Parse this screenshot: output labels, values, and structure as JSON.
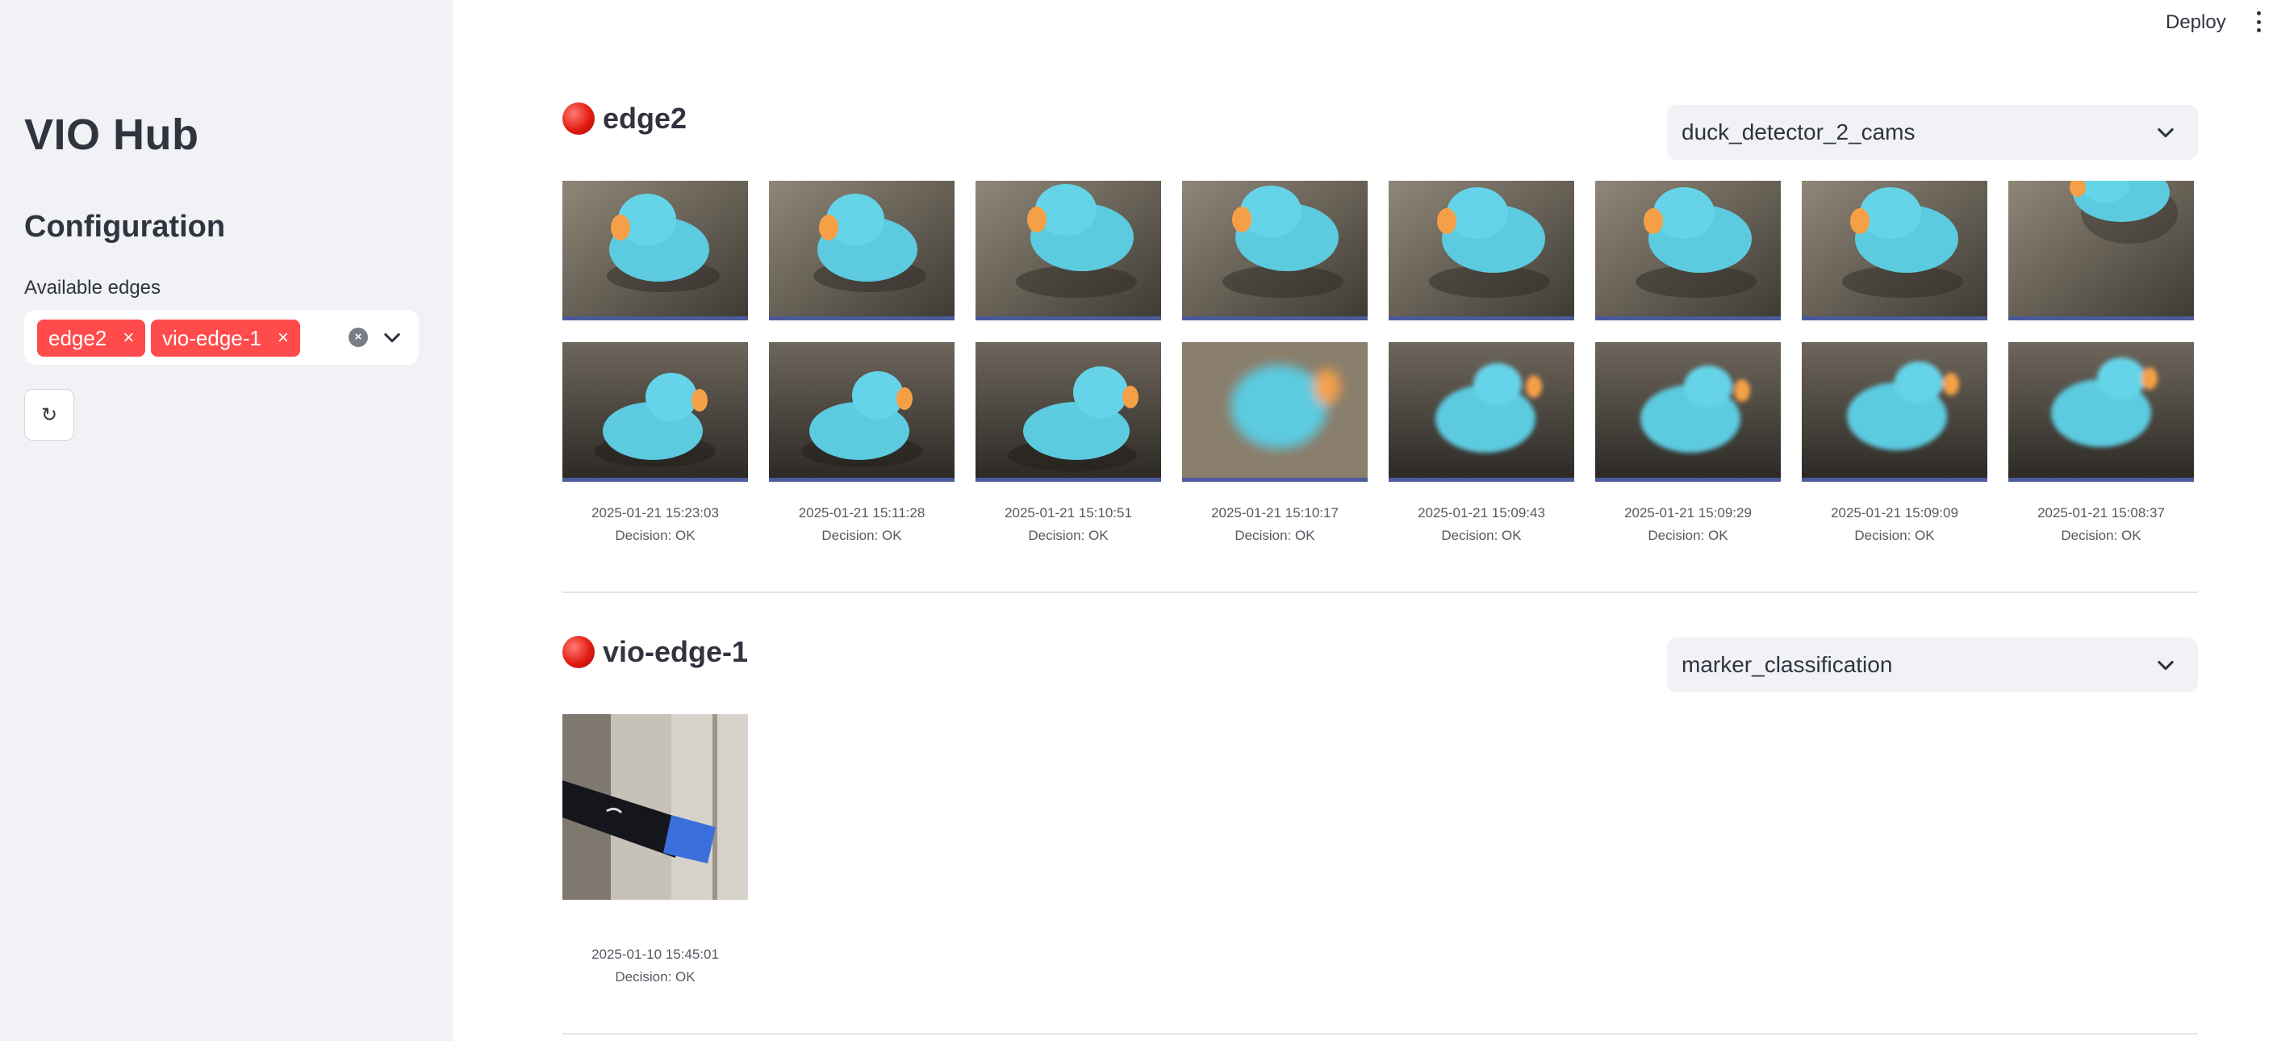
{
  "sidebar": {
    "app_title": "VIO Hub",
    "config_title": "Configuration",
    "edges_label": "Available edges",
    "selected_edges": [
      "edge2",
      "vio-edge-1"
    ],
    "chip_remove": "×",
    "clear_all": "×",
    "refresh_label": "↻"
  },
  "header": {
    "deploy_label": "Deploy"
  },
  "sections": [
    {
      "edge": "edge2",
      "selected_model": "duck_detector_2_cams",
      "images": [
        {
          "timestamp": "2025-01-21 15:23:03",
          "decision": "Decision: OK"
        },
        {
          "timestamp": "2025-01-21 15:11:28",
          "decision": "Decision: OK"
        },
        {
          "timestamp": "2025-01-21 15:10:51",
          "decision": "Decision: OK"
        },
        {
          "timestamp": "2025-01-21 15:10:17",
          "decision": "Decision: OK"
        },
        {
          "timestamp": "2025-01-21 15:09:43",
          "decision": "Decision: OK"
        },
        {
          "timestamp": "2025-01-21 15:09:29",
          "decision": "Decision: OK"
        },
        {
          "timestamp": "2025-01-21 15:09:09",
          "decision": "Decision: OK"
        },
        {
          "timestamp": "2025-01-21 15:08:37",
          "decision": "Decision: OK"
        }
      ]
    },
    {
      "edge": "vio-edge-1",
      "selected_model": "marker_classification",
      "images": [
        {
          "timestamp": "2025-01-10 15:45:01",
          "decision": "Decision: OK"
        }
      ]
    }
  ],
  "colors": {
    "accent": "#ff4b4b",
    "sidebar_bg": "#f0f2f6",
    "text": "#31333f",
    "duck": "#5ccbe0"
  }
}
